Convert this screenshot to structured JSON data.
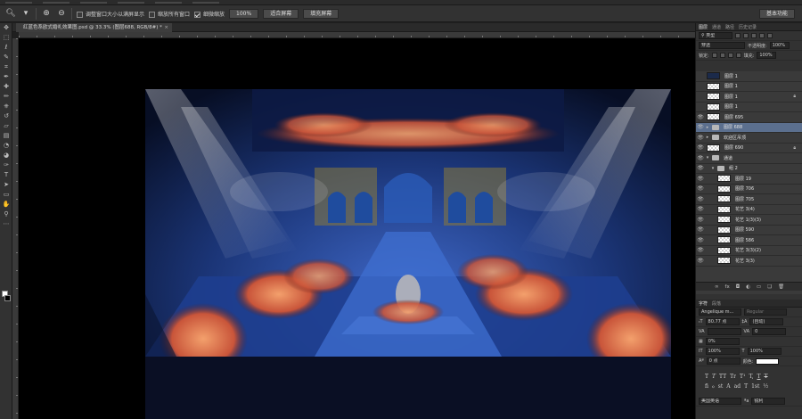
{
  "options_bar": {
    "resize_windows_label": "调整窗口大小以满屏显示",
    "zoom_all_windows_label": "缩放所有窗口",
    "scrubby_zoom_label": "细微缩放",
    "btn_100": "100%",
    "btn_fit_screen": "适合屏幕",
    "btn_fill_screen": "填充屏幕",
    "workspace": "基本功能"
  },
  "document_tab": {
    "title": "红蓝色系欧式婚礼效果图.psd @ 33.3% (图层688, RGB/8#) *",
    "close": "×"
  },
  "layers_panel": {
    "tabs": [
      "图层",
      "通道",
      "路径",
      "历史记录"
    ],
    "kind_filter": "类型",
    "blend_mode": "穿透",
    "opacity_label": "不透明度:",
    "opacity_value": "100%",
    "lock_label": "锁定:",
    "fill_label": "填充:",
    "fill_value": "100%",
    "layers": [
      {
        "name": "图层 1",
        "kind": "layer",
        "thumb": "dark",
        "visible": false,
        "locked": false,
        "selected": false,
        "indent": 0
      },
      {
        "name": "图层 1",
        "kind": "layer",
        "thumb": "checker",
        "visible": false,
        "locked": false,
        "selected": false,
        "indent": 0
      },
      {
        "name": "图层 1",
        "kind": "layer",
        "thumb": "checker",
        "visible": false,
        "locked": true,
        "selected": false,
        "indent": 0
      },
      {
        "name": "图层 1",
        "kind": "layer",
        "thumb": "checker",
        "visible": false,
        "locked": false,
        "selected": false,
        "indent": 0
      },
      {
        "name": "图层 695",
        "kind": "layer",
        "thumb": "checker",
        "visible": true,
        "locked": false,
        "selected": false,
        "indent": 0
      },
      {
        "name": "图层 688",
        "kind": "group",
        "thumb": "folder",
        "visible": true,
        "locked": false,
        "selected": true,
        "indent": 0
      },
      {
        "name": "欢迎区吊顶",
        "kind": "group",
        "thumb": "folder",
        "visible": true,
        "locked": false,
        "selected": false,
        "indent": 0
      },
      {
        "name": "图层 690",
        "kind": "layer",
        "thumb": "checker",
        "visible": true,
        "locked": true,
        "selected": false,
        "indent": 0
      },
      {
        "name": "通道",
        "kind": "group",
        "thumb": "folder",
        "visible": true,
        "locked": false,
        "selected": false,
        "indent": 0
      },
      {
        "name": "组 2",
        "kind": "group",
        "thumb": "folder",
        "visible": true,
        "locked": false,
        "selected": false,
        "indent": 1
      },
      {
        "name": "图层 19",
        "kind": "layer",
        "thumb": "checker",
        "visible": true,
        "locked": false,
        "selected": false,
        "indent": 2
      },
      {
        "name": "图层 706",
        "kind": "layer",
        "thumb": "checker",
        "visible": true,
        "locked": false,
        "selected": false,
        "indent": 2
      },
      {
        "name": "图层 705",
        "kind": "layer",
        "thumb": "checker",
        "visible": true,
        "locked": false,
        "selected": false,
        "indent": 2
      },
      {
        "name": "花艺 3(4)",
        "kind": "layer",
        "thumb": "checker",
        "visible": true,
        "locked": false,
        "selected": false,
        "indent": 2
      },
      {
        "name": "花艺 1(3)(3)",
        "kind": "layer",
        "thumb": "checker",
        "visible": true,
        "locked": false,
        "selected": false,
        "indent": 2
      },
      {
        "name": "图层 590",
        "kind": "layer",
        "thumb": "checker",
        "visible": true,
        "locked": false,
        "selected": false,
        "indent": 2
      },
      {
        "name": "图层 586",
        "kind": "layer",
        "thumb": "checker",
        "visible": true,
        "locked": false,
        "selected": false,
        "indent": 2
      },
      {
        "name": "花艺 3(3)(2)",
        "kind": "layer",
        "thumb": "checker",
        "visible": true,
        "locked": false,
        "selected": false,
        "indent": 2
      },
      {
        "name": "花艺 3(3)",
        "kind": "layer",
        "thumb": "checker",
        "visible": true,
        "locked": false,
        "selected": false,
        "indent": 2
      }
    ],
    "footer_icons": [
      "∞",
      "fx",
      "◘",
      "◐",
      "▭",
      "❏",
      "🗑"
    ]
  },
  "character_panel": {
    "tabs": [
      "字符",
      "段落"
    ],
    "font_family": "Angelique m...",
    "font_style": "Regular",
    "font_size": "80.77 点",
    "leading": "(自动)",
    "kerning": "VA",
    "tracking": "0",
    "tsume": "0%",
    "vertical_scale": "100%",
    "horizontal_scale": "100%",
    "baseline_shift": "0 点",
    "color_label": "颜色:",
    "style_buttons": [
      "T",
      "T",
      "TT",
      "Tr",
      "T¹",
      "T,",
      "T",
      "T"
    ],
    "ot_buttons": [
      "fi",
      "ℴ",
      "st",
      "A",
      "ad",
      "T",
      "1st",
      "½"
    ],
    "language": "美国英语",
    "antialias": "锐利"
  },
  "colors": {
    "accent_selection": "#5b6f8e",
    "stage_blue": "#1d3f8a",
    "flower_orange": "#e07a4a"
  }
}
